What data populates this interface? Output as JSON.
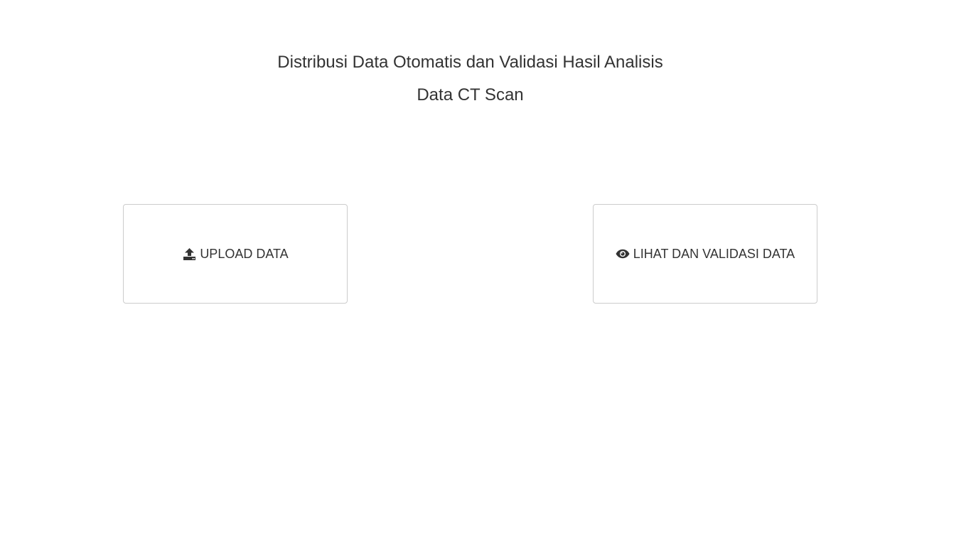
{
  "header": {
    "title": "Distribusi Data Otomatis dan Validasi Hasil Analisis",
    "subtitle": "Data CT Scan"
  },
  "actions": {
    "upload": {
      "icon": "upload-icon",
      "label": "UPLOAD DATA"
    },
    "view": {
      "icon": "eye-icon",
      "label": "LIHAT DAN VALIDASI DATA"
    }
  },
  "colors": {
    "text": "#333333",
    "card_border": "#cccccc",
    "background": "#ffffff"
  }
}
